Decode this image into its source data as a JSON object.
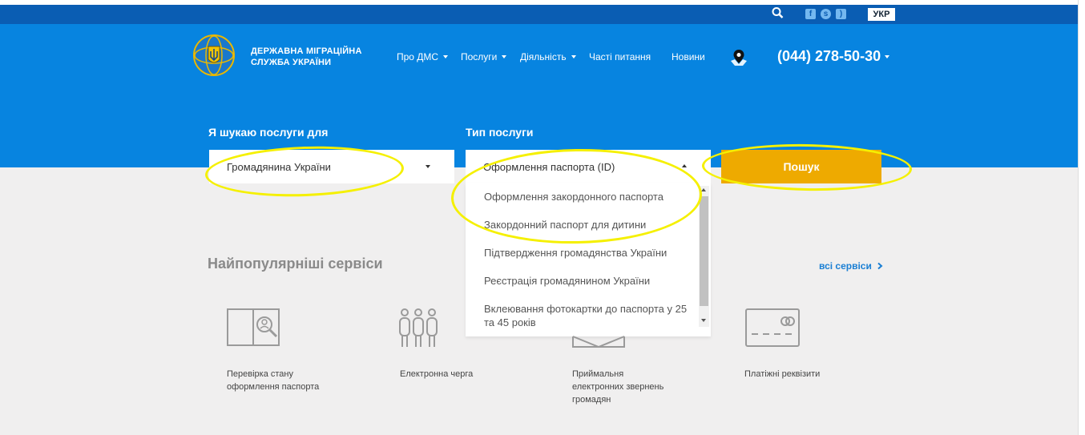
{
  "header": {
    "lang": "УКР",
    "org_name_line1": "ДЕРЖАВНА МІГРАЦІЙНА",
    "org_name_line2": "СЛУЖБА УКРАЇНИ",
    "phone": "(044) 278-50-30",
    "nav": [
      {
        "label": "Про ДМС",
        "has_caret": true
      },
      {
        "label": "Послуги",
        "has_caret": true
      },
      {
        "label": "Діяльність",
        "has_caret": true
      },
      {
        "label": "Часті питання",
        "has_caret": false
      },
      {
        "label": "Новини",
        "has_caret": false
      }
    ],
    "icons": [
      "search-icon",
      "facebook-icon",
      "skype-icon",
      "rss-icon",
      "map-pin-icon",
      "logo-emblem"
    ]
  },
  "search": {
    "for_label": "Я шукаю послуги для",
    "for_value": "Громадянина України",
    "type_label": "Тип послуги",
    "type_value": "Оформлення паспорта (ID)",
    "button_label": "Пошук",
    "options": [
      "Оформлення закордонного паспорта",
      "Закордонний паспорт для дитини",
      "Підтвердження громадянства України",
      "Реєстрація громадянином України",
      "Вклеювання фотокартки до паспорта у 25 та 45 років"
    ]
  },
  "popular": {
    "title": "Найпопулярніші сервіси",
    "all_link": "всі сервіси",
    "services": [
      {
        "label_line1": "Перевірка стану",
        "label_line2": "оформлення паспорта",
        "label_line3": ""
      },
      {
        "label_line1": "Електронна черга",
        "label_line2": "",
        "label_line3": ""
      },
      {
        "label_line1": "Приймальня",
        "label_line2": "електронних звернень",
        "label_line3": "громадян"
      },
      {
        "label_line1": "Платіжні реквізити",
        "label_line2": "",
        "label_line3": ""
      }
    ]
  },
  "colors": {
    "hero_blue": "#0784e0",
    "top_blue": "#0a5db3",
    "button_yellow": "#eeaa00",
    "highlight": "#f5f000",
    "link_blue": "#1a7fd4"
  }
}
